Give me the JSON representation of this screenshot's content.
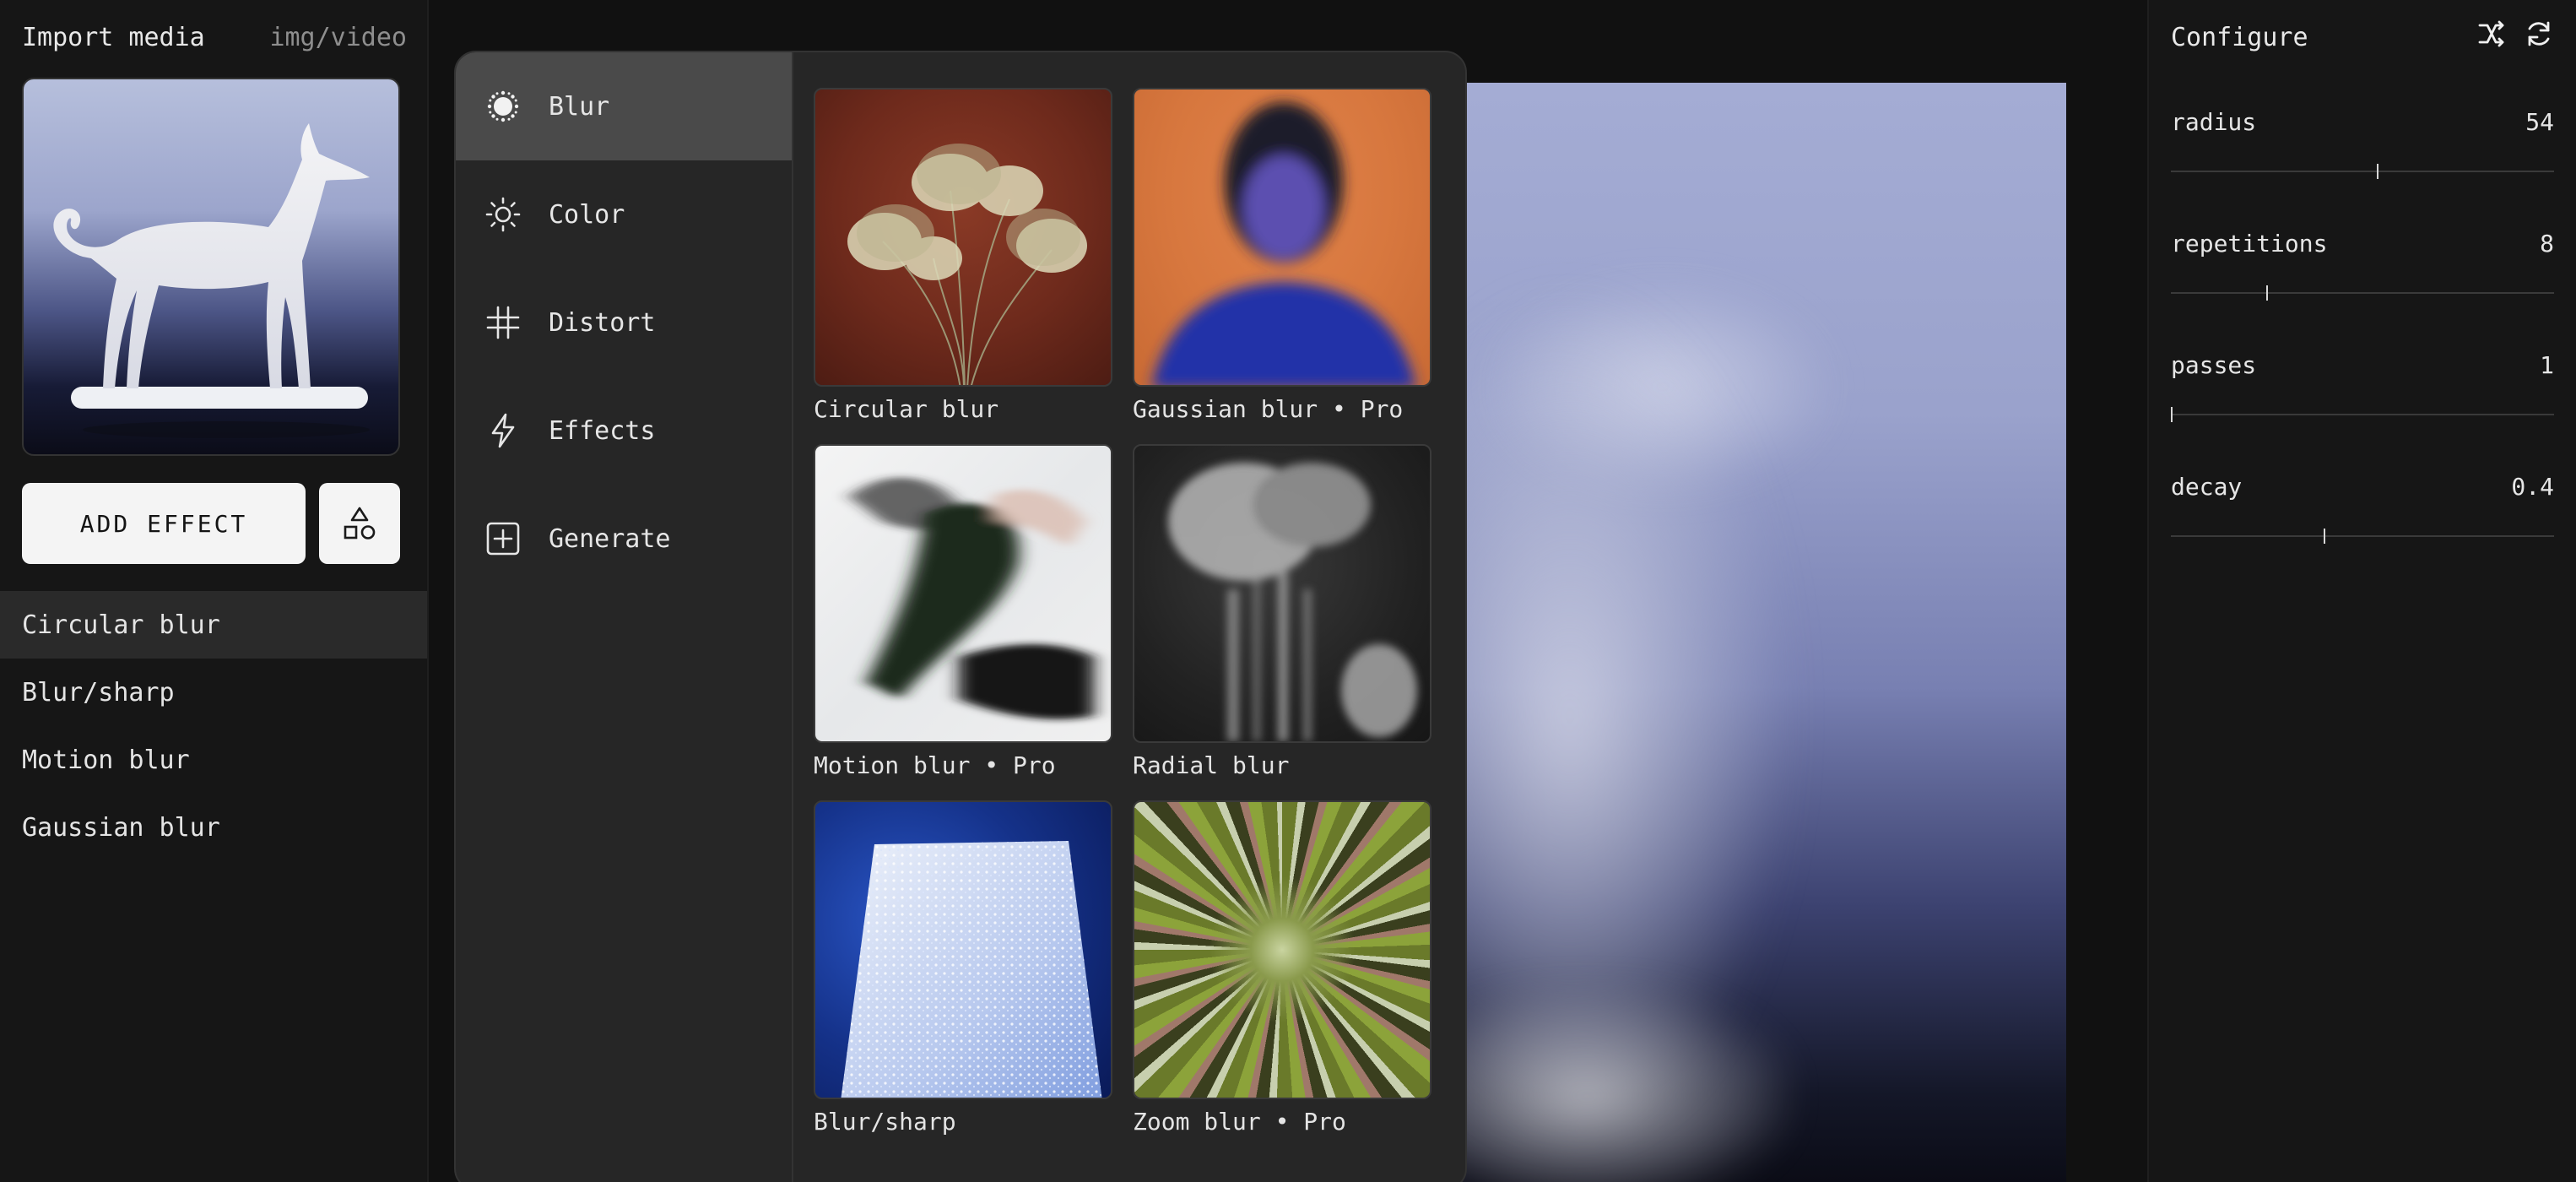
{
  "left": {
    "title": "Import media",
    "type_label": "img/video",
    "add_effect_label": "ADD EFFECT",
    "effects": [
      {
        "label": "Circular blur",
        "active": true
      },
      {
        "label": "Blur/sharp",
        "active": false
      },
      {
        "label": "Motion blur",
        "active": false
      },
      {
        "label": "Gaussian blur",
        "active": false
      }
    ]
  },
  "popover": {
    "categories": [
      {
        "label": "Blur",
        "icon": "blur-icon",
        "active": true
      },
      {
        "label": "Color",
        "icon": "sun-icon",
        "active": false
      },
      {
        "label": "Distort",
        "icon": "grid-hash-icon",
        "active": false
      },
      {
        "label": "Effects",
        "icon": "bolt-icon",
        "active": false
      },
      {
        "label": "Generate",
        "icon": "plus-square-icon",
        "active": false
      }
    ],
    "cards": [
      {
        "label": "Circular blur"
      },
      {
        "label": "Gaussian blur • Pro"
      },
      {
        "label": "Motion blur • Pro"
      },
      {
        "label": "Radial blur"
      },
      {
        "label": "Blur/sharp"
      },
      {
        "label": "Zoom blur • Pro"
      }
    ]
  },
  "configure": {
    "title": "Configure",
    "params": [
      {
        "name": "radius",
        "value": "54",
        "level": 0.54
      },
      {
        "name": "repetitions",
        "value": "8",
        "level": 0.25
      },
      {
        "name": "passes",
        "value": "1",
        "level": 0.0
      },
      {
        "name": "decay",
        "value": "0.4",
        "level": 0.4
      }
    ]
  }
}
